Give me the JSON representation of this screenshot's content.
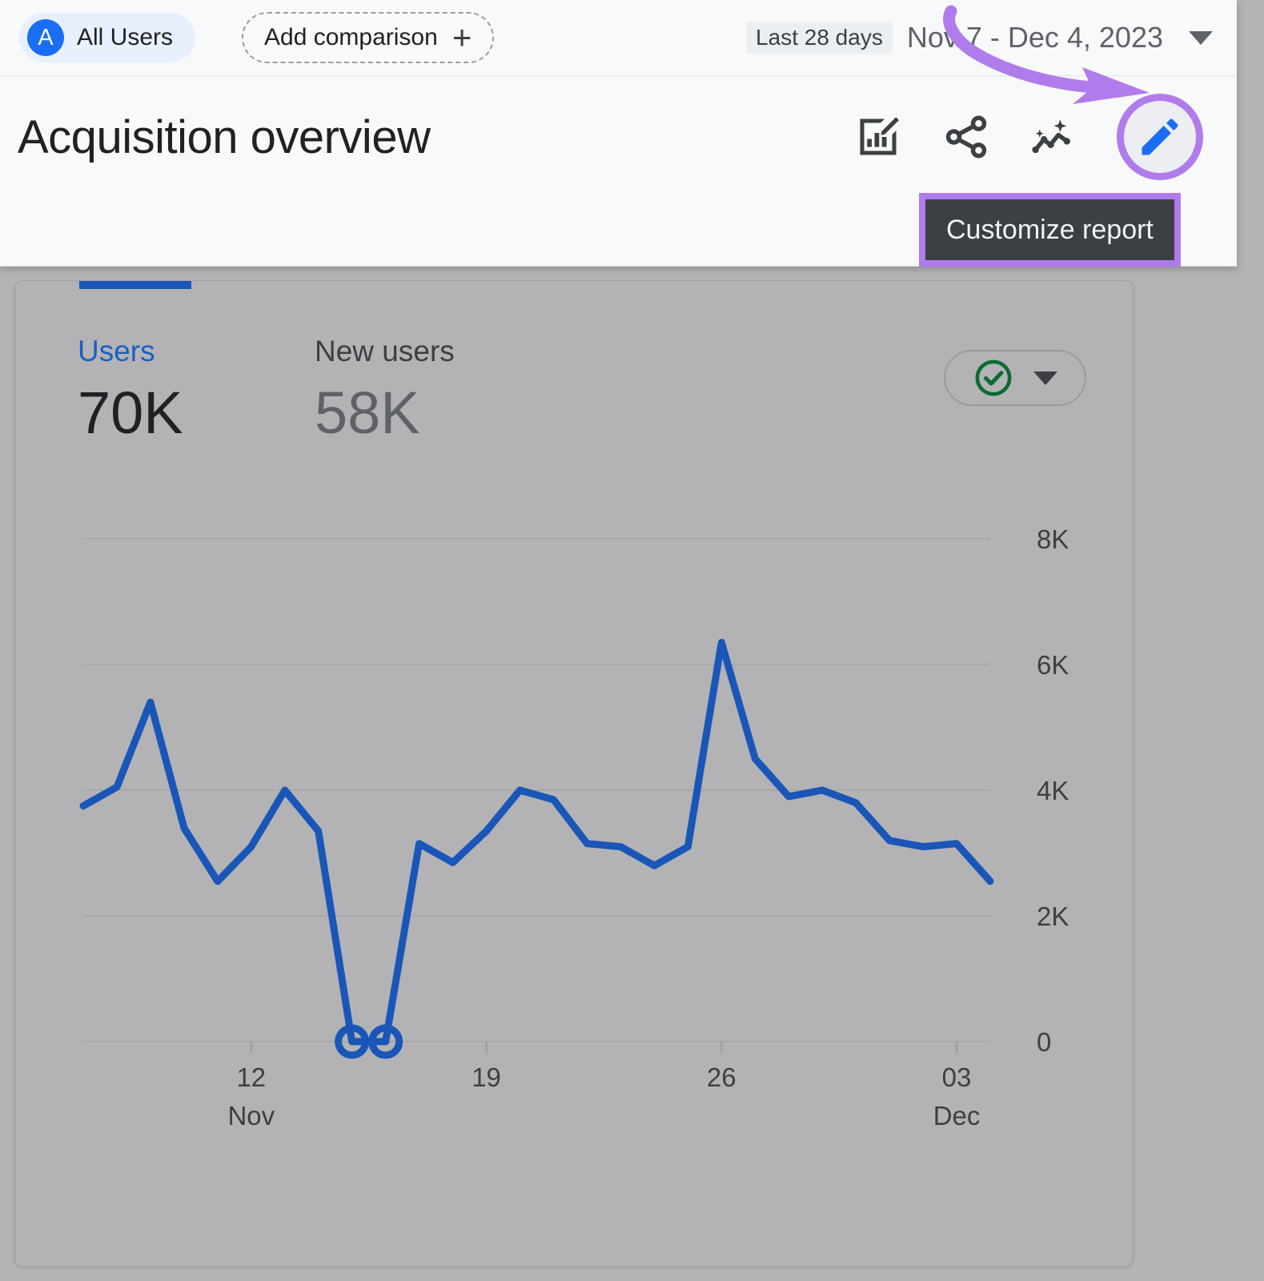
{
  "topbar": {
    "audience_chip": {
      "avatar_letter": "A",
      "label": "All Users"
    },
    "add_comparison": {
      "label": "Add comparison",
      "icon": "plus-icon"
    },
    "date_range": {
      "preset": "Last 28 days",
      "range": "Nov 7 - Dec 4, 2023"
    }
  },
  "header": {
    "title": "Acquisition overview",
    "actions": [
      {
        "name": "edit-chart-icon",
        "tooltip": ""
      },
      {
        "name": "share-icon",
        "tooltip": ""
      },
      {
        "name": "insights-icon",
        "tooltip": ""
      },
      {
        "name": "customize-report-icon",
        "tooltip": "Customize report"
      }
    ],
    "tooltip_text": "Customize report"
  },
  "annotation": {
    "highlight_color": "#b07ceb",
    "arrow": "curved-arrow-pointing-to-customize-report-button"
  },
  "card": {
    "metrics": [
      {
        "label": "Users",
        "value": "70K",
        "selected": true,
        "color": "#1b60c4"
      },
      {
        "label": "New users",
        "value": "58K",
        "selected": false,
        "color": "#5f6368"
      }
    ],
    "status": {
      "icon": "check-circle-icon",
      "color": "#0d6b32",
      "caret": "chevron-down-icon"
    }
  },
  "chart_data": {
    "type": "line",
    "title": "",
    "xlabel": "",
    "ylabel": "",
    "ylim": [
      0,
      8000
    ],
    "yticks": [
      0,
      2000,
      4000,
      6000,
      8000
    ],
    "ytick_labels": [
      "0",
      "2K",
      "4K",
      "6K",
      "8K"
    ],
    "grid": true,
    "legend": false,
    "line_color": "#1a56b8",
    "xtick_labels": [
      "12",
      "19",
      "26",
      "03"
    ],
    "xtick_sublabels": [
      "Nov",
      "",
      "",
      "Dec"
    ],
    "x": [
      "Nov 7",
      "Nov 8",
      "Nov 9",
      "Nov 10",
      "Nov 11",
      "Nov 12",
      "Nov 13",
      "Nov 14",
      "Nov 15",
      "Nov 16",
      "Nov 17",
      "Nov 18",
      "Nov 19",
      "Nov 20",
      "Nov 21",
      "Nov 22",
      "Nov 23",
      "Nov 24",
      "Nov 25",
      "Nov 26",
      "Nov 27",
      "Nov 28",
      "Nov 29",
      "Nov 30",
      "Dec 1",
      "Dec 2",
      "Dec 3",
      "Dec 4"
    ],
    "series": [
      {
        "name": "Users",
        "values": [
          3750,
          4050,
          5400,
          3400,
          2550,
          3100,
          4000,
          3350,
          0,
          0,
          3150,
          2850,
          3350,
          4000,
          3850,
          3150,
          3100,
          2800,
          3100,
          6350,
          4500,
          3900,
          4000,
          3800,
          3200,
          3100,
          3150,
          2550
        ]
      }
    ],
    "markers": [
      {
        "x_index": 8,
        "y": 0
      },
      {
        "x_index": 9,
        "y": 0
      }
    ]
  }
}
